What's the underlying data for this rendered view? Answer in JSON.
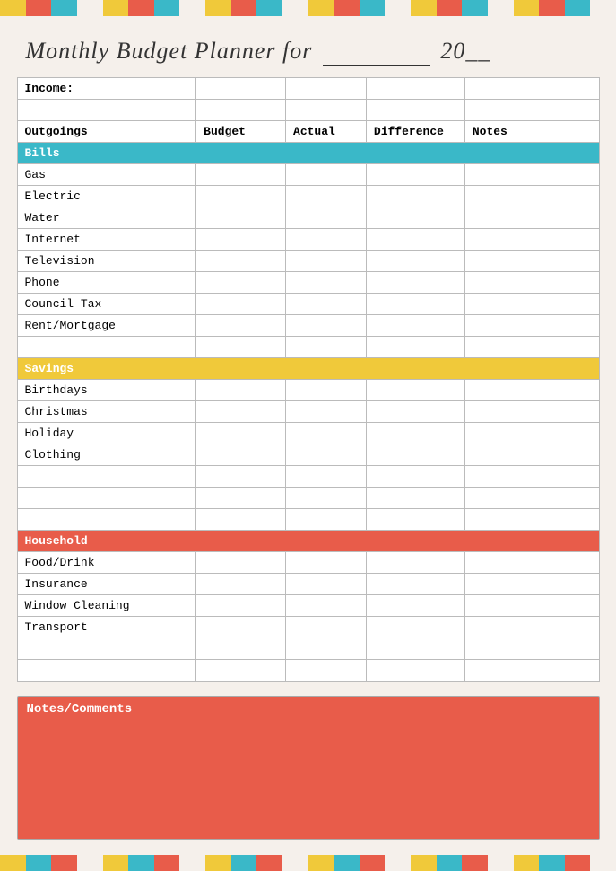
{
  "page": {
    "title_part1": "Monthly Budget Planner for",
    "title_line": "___________",
    "title_year": "20__"
  },
  "topbar": [
    "yellow",
    "red",
    "teal",
    "white",
    "yellow",
    "red",
    "teal",
    "white",
    "yellow",
    "red",
    "teal",
    "white",
    "yellow",
    "red",
    "teal",
    "white",
    "yellow",
    "red",
    "teal",
    "white",
    "yellow",
    "red",
    "teal"
  ],
  "bottombar": [
    "yellow",
    "teal",
    "red",
    "white",
    "yellow",
    "teal",
    "red",
    "white",
    "yellow",
    "teal",
    "red",
    "white",
    "yellow",
    "teal",
    "red",
    "white",
    "yellow",
    "teal",
    "red",
    "white",
    "yellow",
    "teal",
    "red"
  ],
  "table": {
    "income_label": "Income:",
    "col_outgoings": "Outgoings",
    "col_budget": "Budget",
    "col_actual": "Actual",
    "col_diff": "Difference",
    "col_notes": "Notes",
    "section_bills": "Bills",
    "bills_items": [
      "Gas",
      "Electric",
      "Water",
      "Internet",
      "Television",
      "Phone",
      "Council Tax",
      "Rent/Mortgage"
    ],
    "section_savings": "Savings",
    "savings_items": [
      "Birthdays",
      "Christmas",
      "Holiday",
      "Clothing"
    ],
    "savings_blanks": 2,
    "section_household": "Household",
    "household_items": [
      "Food/Drink",
      "Insurance",
      "Window Cleaning",
      "Transport"
    ],
    "household_blanks": 2
  },
  "notes": {
    "header": "Notes/Comments"
  }
}
